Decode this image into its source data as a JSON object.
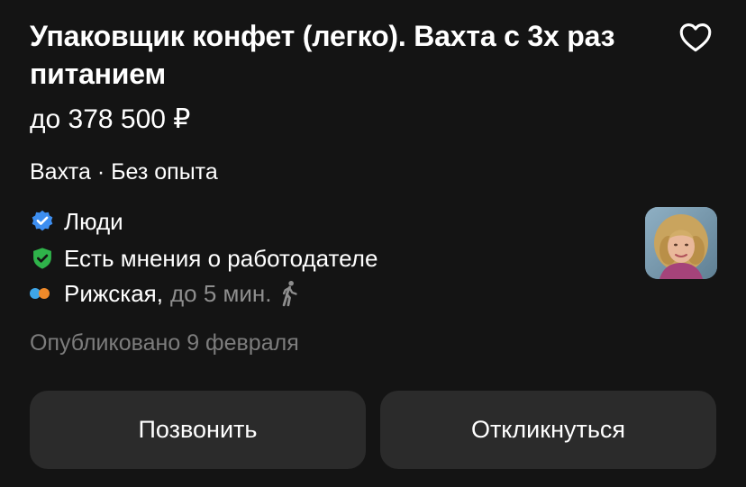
{
  "vacancy": {
    "title": "Упаковщик конфет (легко). Вахта с 3х раз питанием",
    "salary": "до 378 500 ₽",
    "tags": "Вахта · Без опыта",
    "company": "Люди",
    "reviews": "Есть мнения о работодателе",
    "metro_station": "Рижская,",
    "metro_time": "до 5 мин.",
    "published": "Опубликовано 9 февраля"
  },
  "actions": {
    "call_label": "Позвонить",
    "apply_label": "Откликнуться"
  },
  "icons": {
    "favorite": "heart-outline-icon",
    "company_verified": "verified-badge-icon",
    "reviews": "shield-check-icon",
    "walk": "walking-person-icon"
  },
  "colors": {
    "background": "#141414",
    "button_bg": "#2b2b2b",
    "verified_blue": "#3d8ef0",
    "shield_green": "#2fb34a",
    "metro_blue": "#3ea6e8",
    "metro_orange": "#f08a2a",
    "muted_text": "#7d7d7d"
  }
}
